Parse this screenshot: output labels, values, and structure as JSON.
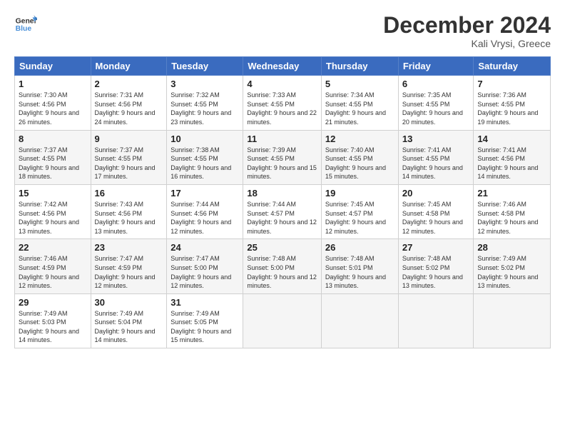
{
  "logo": {
    "line1": "General",
    "line2": "Blue"
  },
  "title": "December 2024",
  "location": "Kali Vrysi, Greece",
  "days_of_week": [
    "Sunday",
    "Monday",
    "Tuesday",
    "Wednesday",
    "Thursday",
    "Friday",
    "Saturday"
  ],
  "weeks": [
    [
      {
        "day": "1",
        "sunrise": "7:30 AM",
        "sunset": "4:56 PM",
        "daylight": "9 hours and 26 minutes."
      },
      {
        "day": "2",
        "sunrise": "7:31 AM",
        "sunset": "4:56 PM",
        "daylight": "9 hours and 24 minutes."
      },
      {
        "day": "3",
        "sunrise": "7:32 AM",
        "sunset": "4:55 PM",
        "daylight": "9 hours and 23 minutes."
      },
      {
        "day": "4",
        "sunrise": "7:33 AM",
        "sunset": "4:55 PM",
        "daylight": "9 hours and 22 minutes."
      },
      {
        "day": "5",
        "sunrise": "7:34 AM",
        "sunset": "4:55 PM",
        "daylight": "9 hours and 21 minutes."
      },
      {
        "day": "6",
        "sunrise": "7:35 AM",
        "sunset": "4:55 PM",
        "daylight": "9 hours and 20 minutes."
      },
      {
        "day": "7",
        "sunrise": "7:36 AM",
        "sunset": "4:55 PM",
        "daylight": "9 hours and 19 minutes."
      }
    ],
    [
      {
        "day": "8",
        "sunrise": "7:37 AM",
        "sunset": "4:55 PM",
        "daylight": "9 hours and 18 minutes."
      },
      {
        "day": "9",
        "sunrise": "7:37 AM",
        "sunset": "4:55 PM",
        "daylight": "9 hours and 17 minutes."
      },
      {
        "day": "10",
        "sunrise": "7:38 AM",
        "sunset": "4:55 PM",
        "daylight": "9 hours and 16 minutes."
      },
      {
        "day": "11",
        "sunrise": "7:39 AM",
        "sunset": "4:55 PM",
        "daylight": "9 hours and 15 minutes."
      },
      {
        "day": "12",
        "sunrise": "7:40 AM",
        "sunset": "4:55 PM",
        "daylight": "9 hours and 15 minutes."
      },
      {
        "day": "13",
        "sunrise": "7:41 AM",
        "sunset": "4:55 PM",
        "daylight": "9 hours and 14 minutes."
      },
      {
        "day": "14",
        "sunrise": "7:41 AM",
        "sunset": "4:56 PM",
        "daylight": "9 hours and 14 minutes."
      }
    ],
    [
      {
        "day": "15",
        "sunrise": "7:42 AM",
        "sunset": "4:56 PM",
        "daylight": "9 hours and 13 minutes."
      },
      {
        "day": "16",
        "sunrise": "7:43 AM",
        "sunset": "4:56 PM",
        "daylight": "9 hours and 13 minutes."
      },
      {
        "day": "17",
        "sunrise": "7:44 AM",
        "sunset": "4:56 PM",
        "daylight": "9 hours and 12 minutes."
      },
      {
        "day": "18",
        "sunrise": "7:44 AM",
        "sunset": "4:57 PM",
        "daylight": "9 hours and 12 minutes."
      },
      {
        "day": "19",
        "sunrise": "7:45 AM",
        "sunset": "4:57 PM",
        "daylight": "9 hours and 12 minutes."
      },
      {
        "day": "20",
        "sunrise": "7:45 AM",
        "sunset": "4:58 PM",
        "daylight": "9 hours and 12 minutes."
      },
      {
        "day": "21",
        "sunrise": "7:46 AM",
        "sunset": "4:58 PM",
        "daylight": "9 hours and 12 minutes."
      }
    ],
    [
      {
        "day": "22",
        "sunrise": "7:46 AM",
        "sunset": "4:59 PM",
        "daylight": "9 hours and 12 minutes."
      },
      {
        "day": "23",
        "sunrise": "7:47 AM",
        "sunset": "4:59 PM",
        "daylight": "9 hours and 12 minutes."
      },
      {
        "day": "24",
        "sunrise": "7:47 AM",
        "sunset": "5:00 PM",
        "daylight": "9 hours and 12 minutes."
      },
      {
        "day": "25",
        "sunrise": "7:48 AM",
        "sunset": "5:00 PM",
        "daylight": "9 hours and 12 minutes."
      },
      {
        "day": "26",
        "sunrise": "7:48 AM",
        "sunset": "5:01 PM",
        "daylight": "9 hours and 13 minutes."
      },
      {
        "day": "27",
        "sunrise": "7:48 AM",
        "sunset": "5:02 PM",
        "daylight": "9 hours and 13 minutes."
      },
      {
        "day": "28",
        "sunrise": "7:49 AM",
        "sunset": "5:02 PM",
        "daylight": "9 hours and 13 minutes."
      }
    ],
    [
      {
        "day": "29",
        "sunrise": "7:49 AM",
        "sunset": "5:03 PM",
        "daylight": "9 hours and 14 minutes."
      },
      {
        "day": "30",
        "sunrise": "7:49 AM",
        "sunset": "5:04 PM",
        "daylight": "9 hours and 14 minutes."
      },
      {
        "day": "31",
        "sunrise": "7:49 AM",
        "sunset": "5:05 PM",
        "daylight": "9 hours and 15 minutes."
      },
      null,
      null,
      null,
      null
    ]
  ],
  "labels": {
    "sunrise": "Sunrise:",
    "sunset": "Sunset:",
    "daylight": "Daylight:"
  }
}
